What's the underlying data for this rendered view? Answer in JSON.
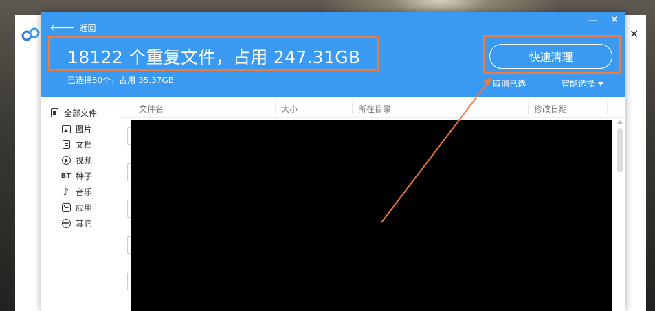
{
  "header": {
    "back_label": "返回",
    "title": "18122 个重复文件，占用 247.31GB",
    "subtitle": "已选择50个，占用 35.37GB",
    "quick_clean_label": "快速清理",
    "deselect_label": "取消已选",
    "smart_select_label": "智能选择",
    "minimize_glyph": "—",
    "close_glyph": "✕"
  },
  "sidebar": {
    "items": [
      {
        "label": "全部文件",
        "icon": "document-icon"
      },
      {
        "label": "图片",
        "icon": "image-icon"
      },
      {
        "label": "文档",
        "icon": "text-doc-icon"
      },
      {
        "label": "视频",
        "icon": "play-icon"
      },
      {
        "label": "种子",
        "icon": "bt-icon",
        "icon_text": "BT"
      },
      {
        "label": "音乐",
        "icon": "music-note-icon"
      },
      {
        "label": "应用",
        "icon": "app-icon"
      },
      {
        "label": "其它",
        "icon": "more-icon"
      }
    ]
  },
  "table": {
    "columns": [
      "文件名",
      "大小",
      "所在目录",
      "修改日期"
    ]
  },
  "background_window": {
    "close_glyph": "✕"
  },
  "colors": {
    "header_blue": "#3a99f0",
    "annotation_orange": "#f07a3a"
  }
}
